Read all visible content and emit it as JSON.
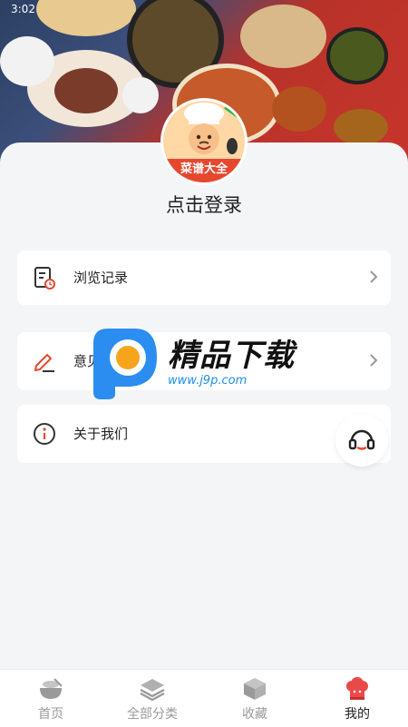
{
  "status_bar": {
    "time": "3:02"
  },
  "profile": {
    "avatar_badge_text": "菜谱大全",
    "login_prompt": "点击登录"
  },
  "menu": {
    "items": [
      {
        "label": "浏览记录",
        "icon": "history-document-icon"
      },
      {
        "label": "意见反馈",
        "icon": "edit-pen-icon"
      },
      {
        "label": "关于我们",
        "icon": "info-icon"
      }
    ]
  },
  "watermark": {
    "title": "精品下载",
    "url": "www.j9p.com"
  },
  "tabbar": {
    "tabs": [
      {
        "label": "首页",
        "icon": "bowl-icon",
        "active": false
      },
      {
        "label": "全部分类",
        "icon": "layers-icon",
        "active": false
      },
      {
        "label": "收藏",
        "icon": "box-icon",
        "active": false
      },
      {
        "label": "我的",
        "icon": "chef-hat-icon",
        "active": true
      }
    ]
  },
  "colors": {
    "accent": "#e5482f",
    "active_tab_icon": "#e84a4a",
    "background": "#f4f5f7"
  }
}
